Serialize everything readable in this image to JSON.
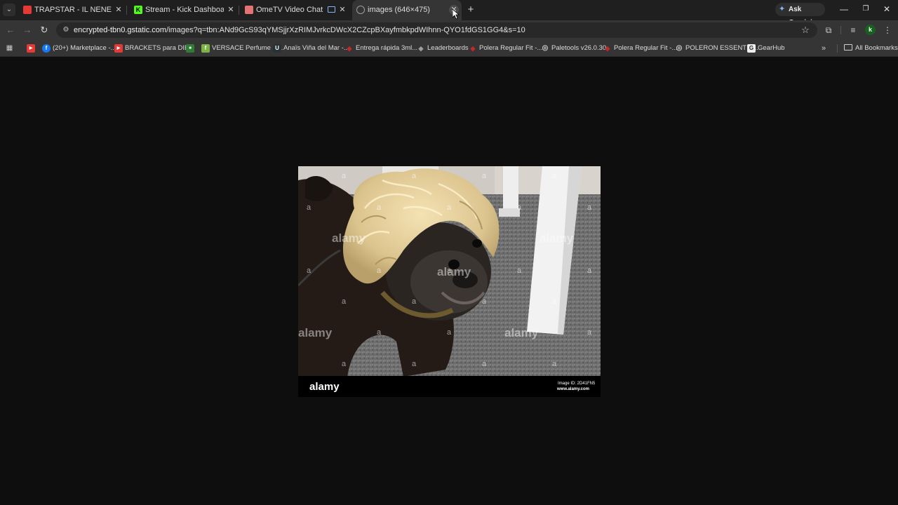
{
  "tabs": [
    {
      "title": "TRAPSTAR - IL NENE (VIDEO OFICIAL)",
      "favicon_color": "#e53935",
      "active": false
    },
    {
      "title": "Stream - Kick Dashboard",
      "favicon_color": "#53fc18",
      "active": false
    },
    {
      "title": "OmeTV Video Chat — Omegle",
      "favicon_color": "#e57373",
      "active": false
    },
    {
      "title": "images (646×475)",
      "favicon_color": "#9e9e9e",
      "active": true
    }
  ],
  "tab_actions": {
    "search_tabs_icon": "chevron-down-icon",
    "close_icon": "✕",
    "new_tab_icon": "+"
  },
  "gemini_button": {
    "label": "Ask Gemini"
  },
  "window_controls": {
    "minimize": "—",
    "restore": "❐",
    "close": "✕"
  },
  "address_bar": {
    "host": "encrypted-tbn0.gstatic.com",
    "path": "/images?q=tbn:ANd9GcS93qYMSjjrXzRIMJvrkcDWcX2CZcpBXayfmbkpdWIhnn-QYO1fdGS1GG4&s=10"
  },
  "profile": {
    "initial": "k"
  },
  "bookmarks": [
    {
      "label": "",
      "icon_color": "#e53935",
      "icon_glyph": "▶"
    },
    {
      "label": "(20+) Marketplace -...",
      "icon_color": "#1877f2",
      "icon_glyph": "f"
    },
    {
      "label": "BRACKETS para DIE...",
      "icon_color": "#e53935",
      "icon_glyph": "▶"
    },
    {
      "label": "",
      "icon_color": "#2e7d32",
      "icon_glyph": "▪"
    },
    {
      "label": "VERSACE Perfume H...",
      "icon_color": "#7cb342",
      "icon_glyph": "f"
    },
    {
      "label": "Anaïs Viña del Mar -...",
      "icon_color": "#263238",
      "icon_glyph": "U"
    },
    {
      "label": "Entrega rápida 3ml...",
      "icon_color": "#c62828",
      "icon_glyph": "◆"
    },
    {
      "label": "Leaderboards",
      "icon_color": "#424242",
      "icon_glyph": "◆"
    },
    {
      "label": "Polera Regular Fit -...",
      "icon_color": "#c62828",
      "icon_glyph": "◆"
    },
    {
      "label": "Paletools v26.0.30",
      "icon_color": "#616161",
      "icon_glyph": "◎"
    },
    {
      "label": "Polera Regular Fit -...",
      "icon_color": "#c62828",
      "icon_glyph": "◆"
    },
    {
      "label": "POLERON ESSENTIA...",
      "icon_color": "#616161",
      "icon_glyph": "◎"
    },
    {
      "label": "GearHub",
      "icon_color": "#eeeeee",
      "icon_glyph": "G"
    }
  ],
  "all_bookmarks_label": "All Bookmarks",
  "image": {
    "watermark_brand": "alamy",
    "image_id_label": "Image ID: 2D41FN5",
    "site_label": "www.alamy.com",
    "watermark_letter": "a"
  }
}
